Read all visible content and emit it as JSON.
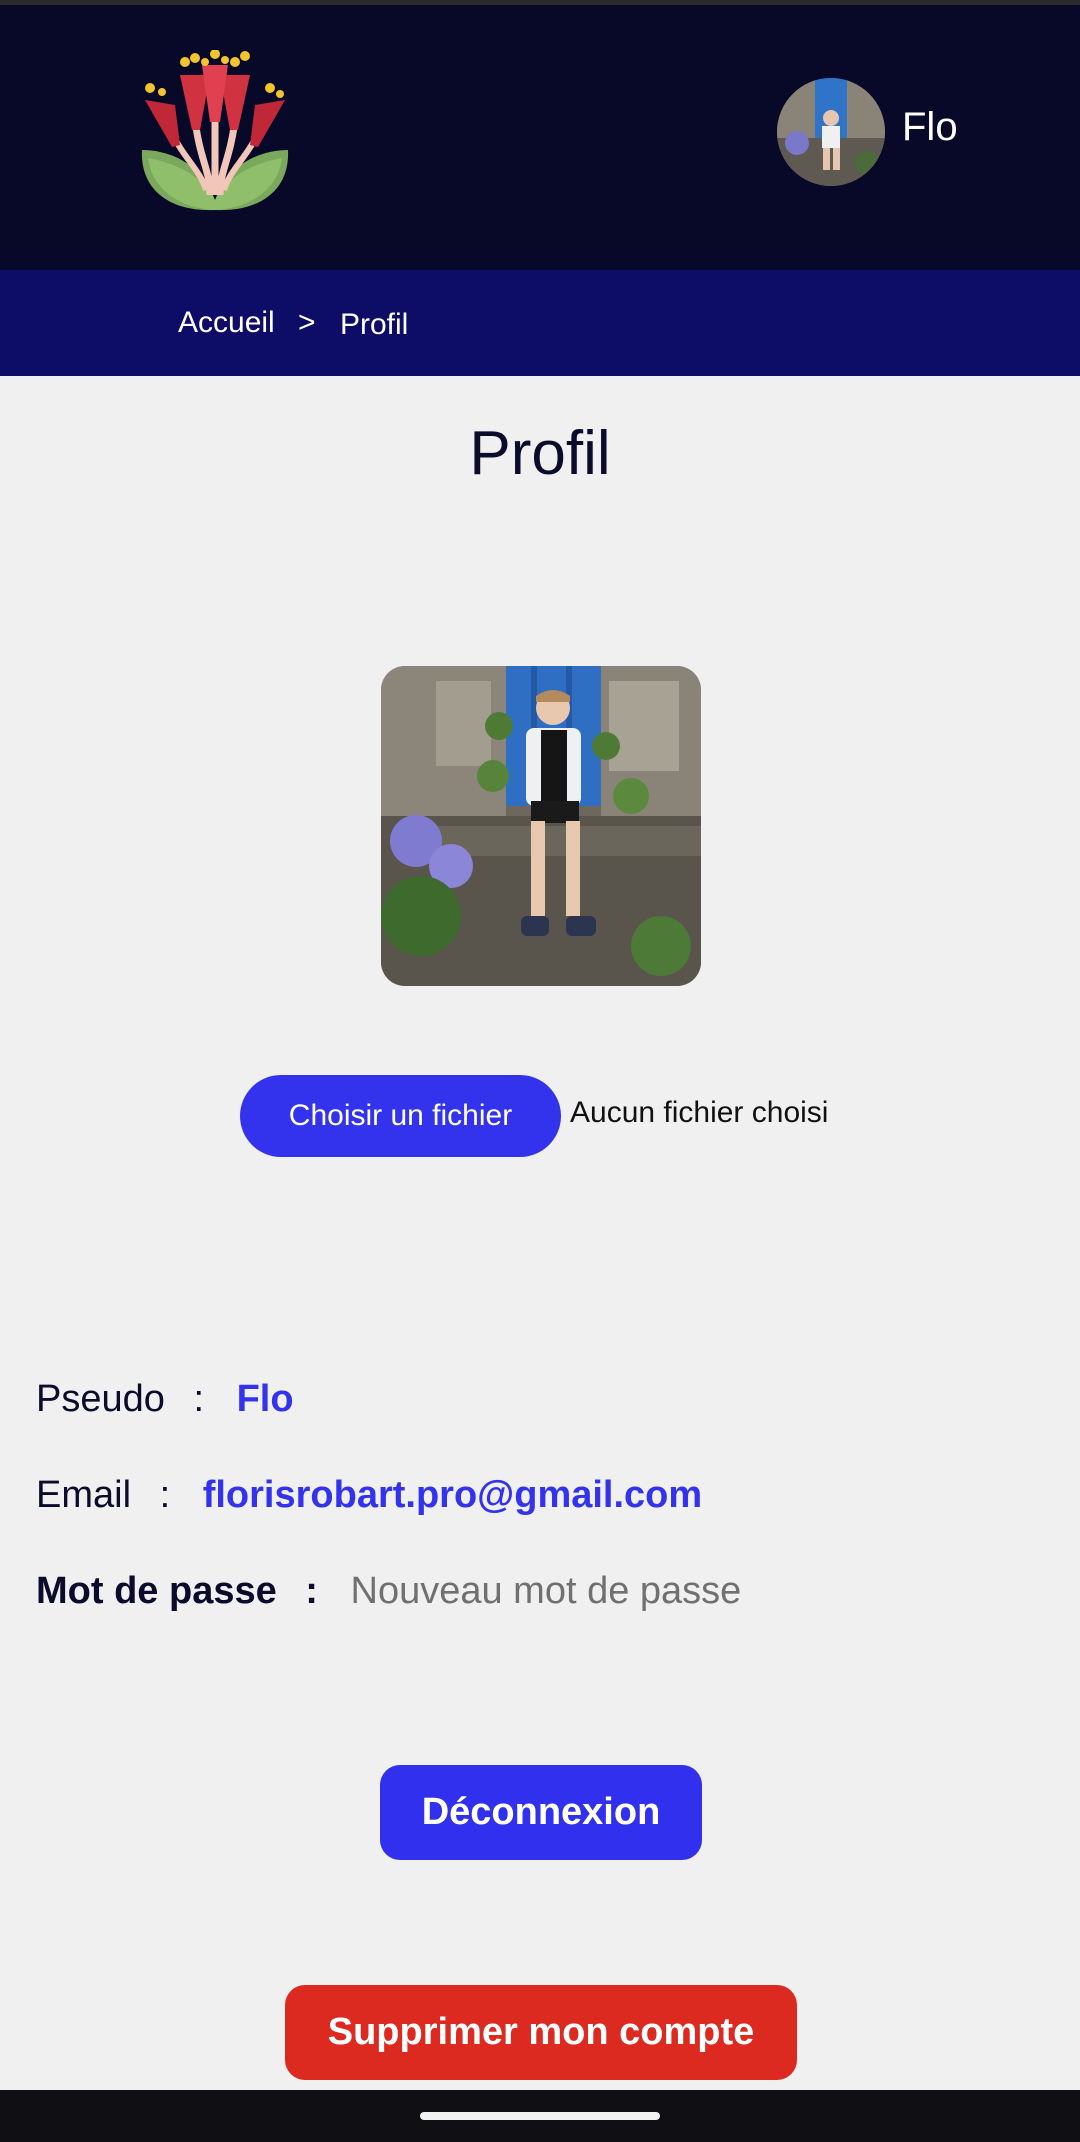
{
  "header": {
    "logo_icon": "flower-logo-icon",
    "user_name": "Flo"
  },
  "breadcrumb": {
    "home": "Accueil",
    "separator": ">",
    "current": "Profil"
  },
  "page": {
    "title": "Profil"
  },
  "upload": {
    "button_label": "Choisir un fichier",
    "status": "Aucun fichier choisi"
  },
  "info": {
    "pseudo_label": "Pseudo",
    "pseudo_value": "Flo",
    "email_label": "Email",
    "email_value": "florisrobart.pro@gmail.com",
    "password_label": "Mot de passe",
    "password_placeholder": "Nouveau mot de passe",
    "colon": ":"
  },
  "actions": {
    "logout_label": "Déconnexion",
    "delete_label": "Supprimer mon compte"
  },
  "colors": {
    "header_bg": "#080828",
    "breadcrumb_bg": "#0d0d68",
    "accent": "#3333ee",
    "danger": "#dd2a21"
  }
}
